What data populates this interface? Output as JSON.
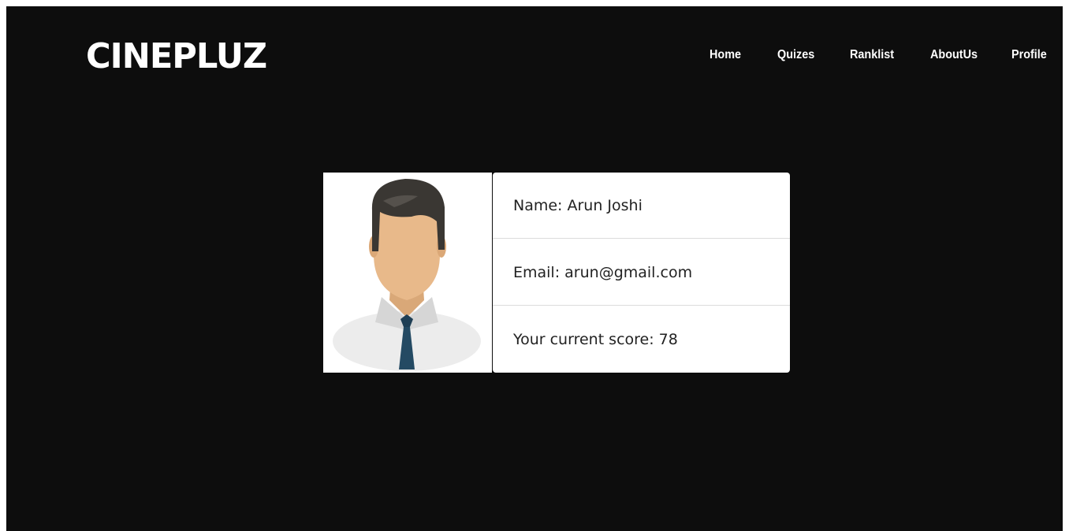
{
  "header": {
    "logo": "CINEPLUZ",
    "nav": [
      {
        "label": "Home"
      },
      {
        "label": "Quizes"
      },
      {
        "label": "Ranklist"
      },
      {
        "label": "AboutUs"
      },
      {
        "label": "Profile"
      }
    ]
  },
  "profile": {
    "avatar_icon": "user-avatar-icon",
    "name_line": "Name: Arun Joshi",
    "email_line": "Email: arun@gmail.com",
    "score_line": "Your current score: 78"
  },
  "colors": {
    "background": "#0d0d0d",
    "text_light": "#ffffff",
    "card_bg": "#ffffff",
    "card_text": "#222222"
  }
}
